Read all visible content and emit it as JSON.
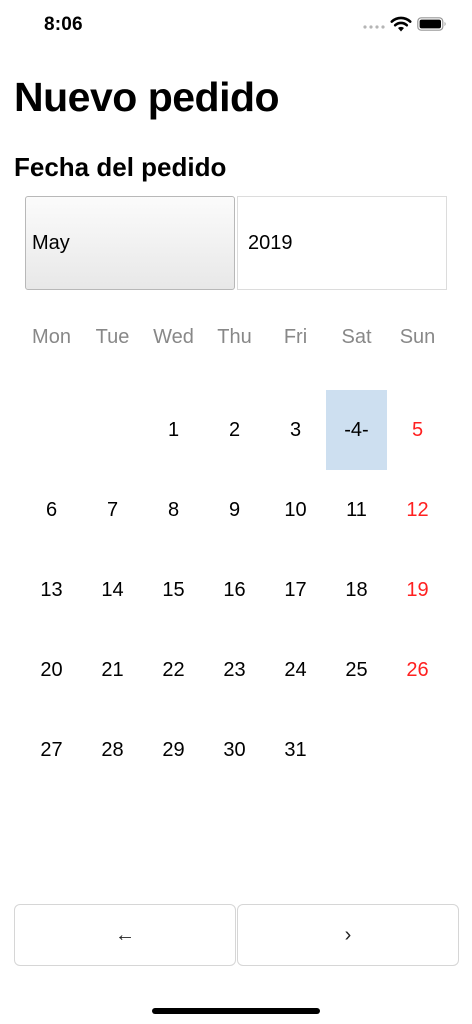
{
  "status_bar": {
    "time": "8:06"
  },
  "header": {
    "title": "Nuevo pedido"
  },
  "order_date": {
    "section_title": "Fecha del pedido",
    "month": "May",
    "year": "2019"
  },
  "calendar": {
    "weekdays": [
      "Mon",
      "Tue",
      "Wed",
      "Thu",
      "Fri",
      "Sat",
      "Sun"
    ],
    "leading_blank_days": 2,
    "days": [
      "1",
      "2",
      "3",
      "-4-",
      "5",
      "6",
      "7",
      "8",
      "9",
      "10",
      "11",
      "12",
      "13",
      "14",
      "15",
      "16",
      "17",
      "18",
      "19",
      "20",
      "21",
      "22",
      "23",
      "24",
      "25",
      "26",
      "27",
      "28",
      "29",
      "30",
      "31"
    ],
    "selected_day": "-4-",
    "weekend_color": "#ff2020",
    "selected_color": "#cddff0"
  },
  "navigation": {
    "prev_label": "←",
    "next_label": "›"
  }
}
